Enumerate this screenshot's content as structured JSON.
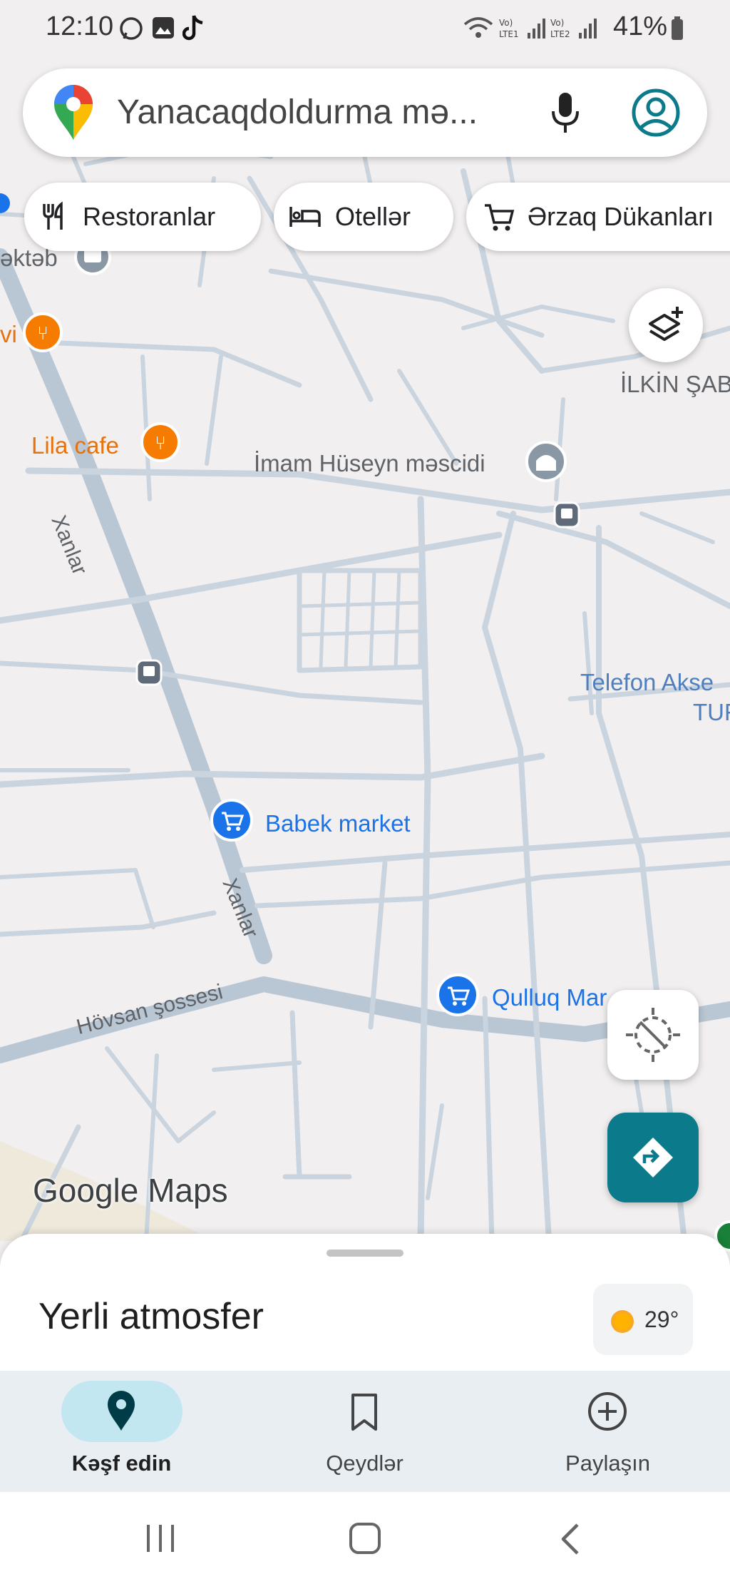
{
  "status_bar": {
    "time": "12:10",
    "battery": "41%",
    "notification_icons": [
      "whatsapp-icon",
      "gallery-icon",
      "tiktok-icon"
    ],
    "system_icons": [
      "wifi-icon",
      "signal-sim1-icon",
      "signal-sim2-icon",
      "battery-icon"
    ]
  },
  "search": {
    "text": "Yanacaqdoldurma mə...",
    "icons": [
      "maps-pin-icon",
      "microphone-icon",
      "account-icon"
    ]
  },
  "chips": [
    {
      "label": "Restoranlar",
      "icon": "restaurant-icon"
    },
    {
      "label": "Otellər",
      "icon": "hotel-icon"
    },
    {
      "label": "Ərzaq Dükanları",
      "icon": "grocery-cart-icon"
    }
  ],
  "map": {
    "labels": {
      "school_partial": "əktəb",
      "restaurant_partial": "vi",
      "lila_cafe": "Lila cafe",
      "mosque": "İmam Hüseyn məscidi",
      "ilkin_partial": "İLKİN ŞAB",
      "xanlar_1": "Xanlar",
      "xanlar_2": "Xanlar",
      "telefon_line1": "Telefon Akse",
      "telefon_line2": "TUR",
      "babek_market": "Babek market",
      "qulluq_market": "Qulluq Mar",
      "hovsan": "Hövsan şossesi"
    },
    "watermark": "Google Maps"
  },
  "colors": {
    "map_bg": "#f2eff0",
    "road": "#c9d4de",
    "main_road": "#b9c6d3",
    "restaurant_pin": "#f57c00",
    "shop_pin": "#1a73e8",
    "directions_fab": "#0b7a8a",
    "nav_active_pill": "#c2e7f0"
  },
  "sheet": {
    "title": "Yerli atmosfer",
    "weather_temp": "29°",
    "weather_icon": "sun-icon"
  },
  "nav": [
    {
      "label": "Kəşf edin",
      "icon": "explore-pin-icon",
      "active": true
    },
    {
      "label": "Qeydlər",
      "icon": "bookmark-icon",
      "active": false
    },
    {
      "label": "Paylaşın",
      "icon": "add-circle-icon",
      "active": false
    }
  ],
  "system_nav": [
    "recents-icon",
    "home-icon",
    "back-icon"
  ]
}
